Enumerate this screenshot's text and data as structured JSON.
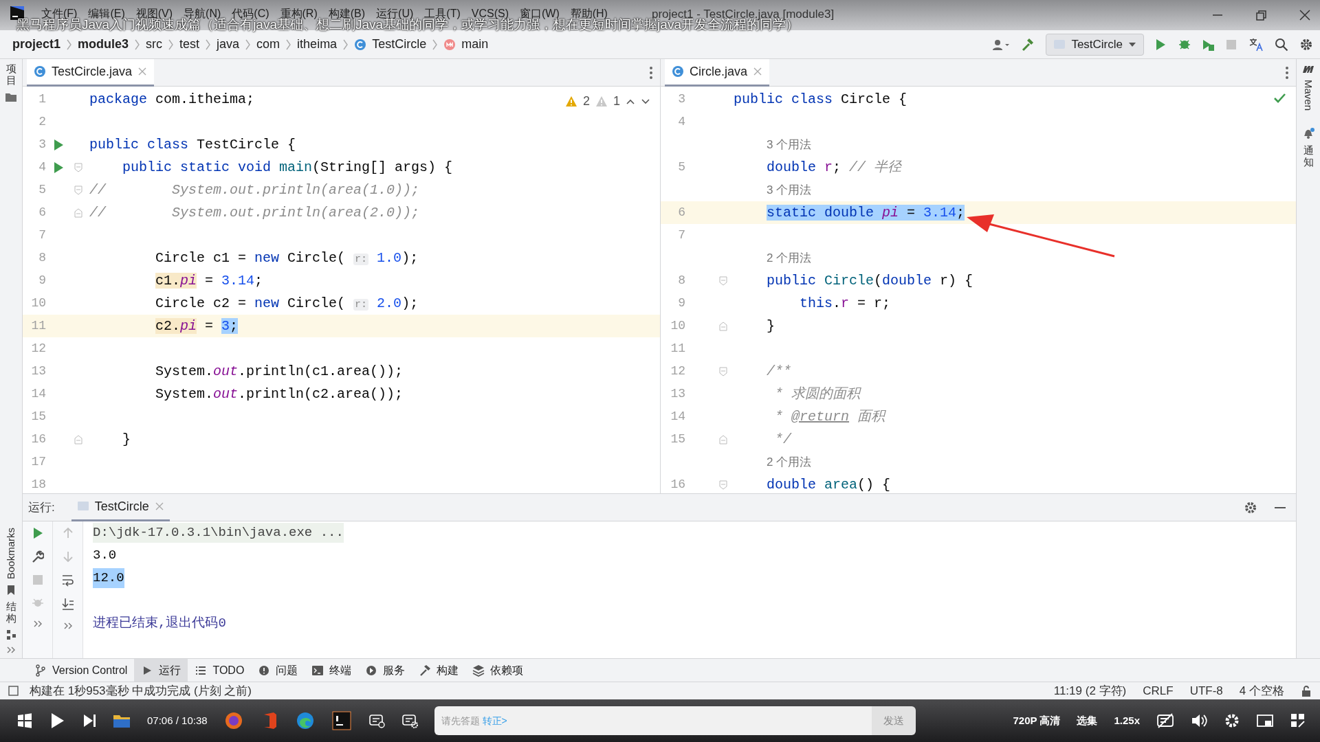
{
  "window": {
    "menu": [
      "文件(F)",
      "编辑(E)",
      "视图(V)",
      "导航(N)",
      "代码(C)",
      "重构(R)",
      "构建(B)",
      "运行(U)",
      "工具(T)",
      "VCS(S)",
      "窗口(W)",
      "帮助(H)"
    ],
    "title": "project1 - TestCircle.java [module3]"
  },
  "video_caption": "黑马程序员Java入门视频速成篇（适合有java基础、想二刷Java基础的同学，或学习能力强，想在更短时间掌握java开发全流程的同学）",
  "breadcrumbs": [
    {
      "label": "project1",
      "kind": "project"
    },
    {
      "label": "module3",
      "kind": "project"
    },
    {
      "label": "src",
      "kind": "folder"
    },
    {
      "label": "test",
      "kind": "folder"
    },
    {
      "label": "java",
      "kind": "folder"
    },
    {
      "label": "com",
      "kind": "folder"
    },
    {
      "label": "itheima",
      "kind": "folder"
    },
    {
      "label": "TestCircle",
      "kind": "class"
    },
    {
      "label": "main",
      "kind": "method"
    }
  ],
  "run_config": "TestCircle",
  "left_strip": {
    "top": [
      {
        "label": "项目",
        "kind": "cjk"
      }
    ],
    "bottom": [
      {
        "label": "Bookmarks",
        "kind": "latin"
      },
      {
        "label": "结构",
        "kind": "cjk"
      }
    ]
  },
  "right_strip": [
    {
      "label": "Maven",
      "kind": "latin"
    },
    {
      "label": "通知",
      "kind": "cjk"
    }
  ],
  "editors": [
    {
      "tab": {
        "label": "TestCircle.java",
        "selected": true
      },
      "inspections": {
        "kind": "counts",
        "warnings": "2",
        "weak_warnings": "1"
      },
      "lines": [
        {
          "kind": "code",
          "n": "1",
          "current": false,
          "tokens": [
            {
              "text": "package",
              "kind": "keyword"
            },
            {
              "text": " com.itheima;",
              "kind": "plain"
            }
          ]
        },
        {
          "kind": "code",
          "n": "2",
          "current": false
        },
        {
          "kind": "code",
          "n": "3",
          "current": false,
          "gutter": [
            {
              "kind": "run"
            }
          ],
          "tokens": [
            {
              "text": "public class",
              "kind": "keyword"
            },
            {
              "text": " TestCircle {",
              "kind": "plain"
            }
          ]
        },
        {
          "kind": "code",
          "n": "4",
          "current": false,
          "gutter": [
            {
              "kind": "run"
            },
            {
              "kind": "fold-start"
            }
          ],
          "tokens": [
            {
              "text": "    public static void ",
              "kind": "keyword"
            },
            {
              "text": "main",
              "kind": "method"
            },
            {
              "text": "(String[] args) {",
              "kind": "plain"
            }
          ]
        },
        {
          "kind": "code",
          "n": "5",
          "current": false,
          "gutter": [
            {
              "kind": "fold-start"
            }
          ],
          "tokens": [
            {
              "text": "//        System.out.println(area(1.0));",
              "kind": "comment"
            }
          ]
        },
        {
          "kind": "code",
          "n": "6",
          "current": false,
          "gutter": [
            {
              "kind": "fold-end"
            }
          ],
          "tokens": [
            {
              "text": "//        System.out.println(area(2.0));",
              "kind": "comment"
            }
          ]
        },
        {
          "kind": "code",
          "n": "7",
          "current": false
        },
        {
          "kind": "code",
          "n": "8",
          "current": false,
          "tokens": [
            {
              "text": "        Circle c1 = ",
              "kind": "plain"
            },
            {
              "text": "new",
              "kind": "keyword"
            },
            {
              "text": " Circle( ",
              "kind": "plain"
            },
            {
              "text": "r:",
              "kind": "hint"
            },
            {
              "text": " 1.0",
              "kind": "number"
            },
            {
              "text": ");",
              "kind": "plain"
            }
          ]
        },
        {
          "kind": "code",
          "n": "9",
          "current": false,
          "tokens": [
            {
              "text": "        c1.",
              "kind": "warning-plain"
            },
            {
              "text": "pi",
              "kind": "warning-static-field"
            },
            {
              "text": " = ",
              "kind": "plain"
            },
            {
              "text": "3.14",
              "kind": "number"
            },
            {
              "text": ";",
              "kind": "plain"
            }
          ]
        },
        {
          "kind": "code",
          "n": "10",
          "current": false,
          "tokens": [
            {
              "text": "        Circle c2 = ",
              "kind": "plain"
            },
            {
              "text": "new",
              "kind": "keyword"
            },
            {
              "text": " Circle( ",
              "kind": "plain"
            },
            {
              "text": "r:",
              "kind": "hint"
            },
            {
              "text": " 2.0",
              "kind": "number"
            },
            {
              "text": ");",
              "kind": "plain"
            }
          ]
        },
        {
          "kind": "code",
          "n": "11",
          "current": true,
          "tokens": [
            {
              "text": "        c2.",
              "kind": "warning-plain"
            },
            {
              "text": "pi",
              "kind": "warning-static-field"
            },
            {
              "text": " = ",
              "kind": "plain"
            },
            {
              "text": "3",
              "kind": "selected-number"
            },
            {
              "text": ";",
              "kind": "selected-plain"
            }
          ]
        },
        {
          "kind": "code",
          "n": "12",
          "current": false
        },
        {
          "kind": "code",
          "n": "13",
          "current": false,
          "tokens": [
            {
              "text": "        System.",
              "kind": "plain"
            },
            {
              "text": "out",
              "kind": "static-field"
            },
            {
              "text": ".println(c1.area());",
              "kind": "plain"
            }
          ]
        },
        {
          "kind": "code",
          "n": "14",
          "current": false,
          "tokens": [
            {
              "text": "        System.",
              "kind": "plain"
            },
            {
              "text": "out",
              "kind": "static-field"
            },
            {
              "text": ".println(c2.area());",
              "kind": "plain"
            }
          ]
        },
        {
          "kind": "code",
          "n": "15",
          "current": false
        },
        {
          "kind": "code",
          "n": "16",
          "current": false,
          "gutter": [
            {
              "kind": "fold-end"
            }
          ],
          "tokens": [
            {
              "text": "    }",
              "kind": "plain"
            }
          ]
        },
        {
          "kind": "code",
          "n": "17",
          "current": false
        },
        {
          "kind": "code",
          "n": "18",
          "current": false
        }
      ]
    },
    {
      "tab": {
        "label": "Circle.java",
        "selected": true
      },
      "inspections": {
        "kind": "ok"
      },
      "lines": [
        {
          "kind": "code",
          "n": "3",
          "current": false,
          "tokens": [
            {
              "text": "public class",
              "kind": "keyword"
            },
            {
              "text": " Circle {",
              "kind": "plain"
            }
          ]
        },
        {
          "kind": "code",
          "n": "4",
          "current": false
        },
        {
          "kind": "usages",
          "text": "3 个用法"
        },
        {
          "kind": "code",
          "n": "5",
          "current": false,
          "tokens": [
            {
              "text": "    double ",
              "kind": "keyword"
            },
            {
              "text": "r",
              "kind": "field"
            },
            {
              "text": "; ",
              "kind": "plain"
            },
            {
              "text": "// 半径",
              "kind": "comment"
            }
          ]
        },
        {
          "kind": "usages",
          "text": "3 个用法"
        },
        {
          "kind": "code",
          "n": "6",
          "current": true,
          "tokens": [
            {
              "text": "    static double ",
              "kind": "selected-keyword"
            },
            {
              "text": "pi",
              "kind": "selected-static-field"
            },
            {
              "text": " = ",
              "kind": "selected-plain"
            },
            {
              "text": "3.14",
              "kind": "selected-number"
            },
            {
              "text": ";",
              "kind": "selected-plain"
            }
          ]
        },
        {
          "kind": "code",
          "n": "7",
          "current": false
        },
        {
          "kind": "usages",
          "text": "2 个用法"
        },
        {
          "kind": "code",
          "n": "8",
          "current": false,
          "gutter": [
            {
              "kind": "fold-start"
            }
          ],
          "tokens": [
            {
              "text": "    public ",
              "kind": "keyword"
            },
            {
              "text": "Circle",
              "kind": "method"
            },
            {
              "text": "(",
              "kind": "plain"
            },
            {
              "text": "double",
              "kind": "keyword"
            },
            {
              "text": " r) {",
              "kind": "plain"
            }
          ]
        },
        {
          "kind": "code",
          "n": "9",
          "current": false,
          "tokens": [
            {
              "text": "        this",
              "kind": "keyword"
            },
            {
              "text": ".",
              "kind": "plain"
            },
            {
              "text": "r",
              "kind": "field"
            },
            {
              "text": " = r;",
              "kind": "plain"
            }
          ]
        },
        {
          "kind": "code",
          "n": "10",
          "current": false,
          "gutter": [
            {
              "kind": "fold-end"
            }
          ],
          "tokens": [
            {
              "text": "    }",
              "kind": "plain"
            }
          ]
        },
        {
          "kind": "code",
          "n": "11",
          "current": false
        },
        {
          "kind": "code",
          "n": "12",
          "current": false,
          "gutter": [
            {
              "kind": "fold-start"
            }
          ],
          "tokens": [
            {
              "text": "    /**",
              "kind": "comment"
            }
          ]
        },
        {
          "kind": "code",
          "n": "13",
          "current": false,
          "tokens": [
            {
              "text": "     * 求圆的面积",
              "kind": "comment"
            }
          ]
        },
        {
          "kind": "code",
          "n": "14",
          "current": false,
          "tokens": [
            {
              "text": "     * ",
              "kind": "comment"
            },
            {
              "text": "@return",
              "kind": "doc-tag"
            },
            {
              "text": " 面积",
              "kind": "comment"
            }
          ]
        },
        {
          "kind": "code",
          "n": "15",
          "current": false,
          "gutter": [
            {
              "kind": "fold-end"
            }
          ],
          "tokens": [
            {
              "text": "     */",
              "kind": "comment"
            }
          ]
        },
        {
          "kind": "usages",
          "text": "2 个用法"
        },
        {
          "kind": "code",
          "n": "16",
          "current": false,
          "gutter": [
            {
              "kind": "fold-start"
            }
          ],
          "tokens": [
            {
              "text": "    double ",
              "kind": "keyword"
            },
            {
              "text": "area",
              "kind": "method"
            },
            {
              "text": "() {",
              "kind": "plain"
            }
          ]
        }
      ]
    }
  ],
  "run_panel": {
    "label": "运行:",
    "tab": "TestCircle",
    "console": [
      {
        "kind": "command",
        "text": "D:\\jdk-17.0.3.1\\bin\\java.exe ..."
      },
      {
        "kind": "output",
        "text": "3.0"
      },
      {
        "kind": "selected-output",
        "text": "12.0"
      },
      {
        "kind": "exit",
        "text": "进程已结束,退出代码0"
      }
    ]
  },
  "tool_windows": [
    {
      "label": "Version Control",
      "selected": false
    },
    {
      "label": "运行",
      "selected": true
    },
    {
      "label": "TODO",
      "selected": false
    },
    {
      "label": "问题",
      "selected": false
    },
    {
      "label": "终端",
      "selected": false
    },
    {
      "label": "服务",
      "selected": false
    },
    {
      "label": "构建",
      "selected": false
    },
    {
      "label": "依赖项",
      "selected": false
    }
  ],
  "status_bar": {
    "message": "构建在 1秒953毫秒 中成功完成 (片刻 之前)",
    "items": [
      "11:19 (2 字符)",
      "CRLF",
      "UTF-8",
      "4 个空格"
    ]
  },
  "player": {
    "time": "07:06 / 10:38",
    "comment_placeholder": "请先答题",
    "comment_link": "转正>",
    "send": "发送",
    "quality": "720P 高清",
    "episodes": "选集",
    "speed": "1.25x"
  }
}
